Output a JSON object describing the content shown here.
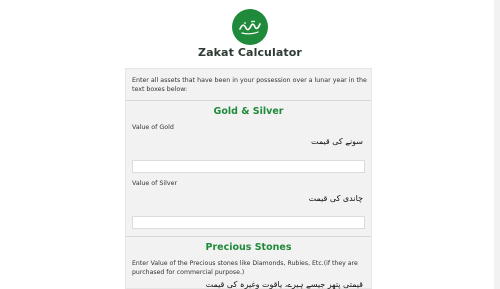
{
  "header": {
    "logo_text": "زکوٰۃ",
    "title": "Zakat Calculator"
  },
  "form": {
    "intro": "Enter all assets that have been in your possession over a lunar year in the text boxes below:",
    "gold_silver": {
      "heading": "Gold & Silver",
      "gold": {
        "label": "Value of Gold",
        "urdu_label": "سونے کی قیمت",
        "value": ""
      },
      "silver": {
        "label": "Value of Silver",
        "urdu_label": "چاندی کی قیمت",
        "value": ""
      }
    },
    "precious_stones": {
      "heading": "Precious Stones",
      "description": "Enter Value of the Precious stones like Diamonds, Rubies, Etc.(if they are purchased for commercial purpose.)",
      "urdu_description": "قیمتی پتھر جیسے ہیرے، یاقوت وغیرہ کی قیمت"
    }
  },
  "colors": {
    "accent": "#1f8a3a",
    "card_background": "#f2f2f2"
  }
}
